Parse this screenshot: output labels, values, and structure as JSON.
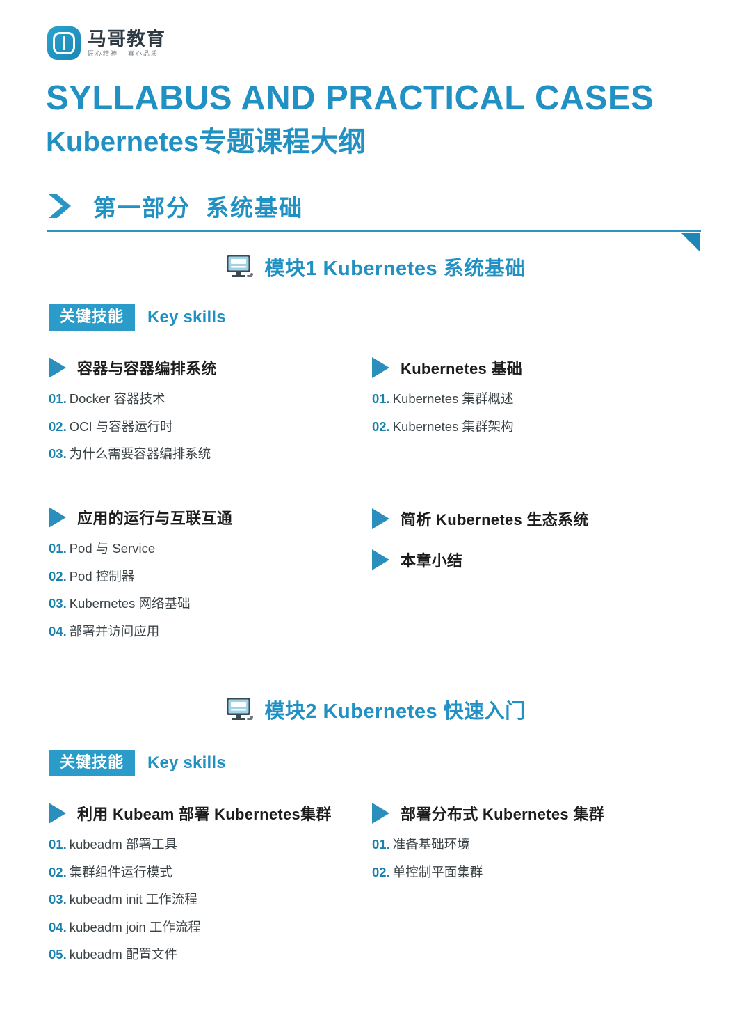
{
  "brand": {
    "name": "马哥教育",
    "tagline": "匠心精神 · 真心品质",
    "logo_icon": "mage-logo-icon",
    "accent_color": "#2190c2",
    "badge_color": "#2b9cc9",
    "number_color": "#1b82ad"
  },
  "header": {
    "title_en": "SYLLABUS AND PRACTICAL CASES",
    "title_cn": "Kubernetes专题课程大纲"
  },
  "part": {
    "chevron_icon": "chevron-right-icon",
    "label": "第一部分",
    "name": "系统基础",
    "corner_icon": "triangle-accent-icon"
  },
  "modules": [
    {
      "icon": "desktop-computer-icon",
      "title": "模块1 Kubernetes 系统基础",
      "skills_badge": "关键技能",
      "skills_en": "Key skills",
      "groups": [
        {
          "bullet_icon": "triangle-right-icon",
          "name": "容器与容器编排系统",
          "items": [
            {
              "num": "01.",
              "text": "Docker 容器技术"
            },
            {
              "num": "02.",
              "text": "OCI 与容器运行时"
            },
            {
              "num": "03.",
              "text": "为什么需要容器编排系统"
            }
          ]
        },
        {
          "bullet_icon": "triangle-right-icon",
          "name": "Kubernetes 基础",
          "items": [
            {
              "num": "01.",
              "text": "Kubernetes 集群概述"
            },
            {
              "num": "02.",
              "text": "Kubernetes 集群架构"
            }
          ]
        },
        {
          "bullet_icon": "triangle-right-icon",
          "name": "应用的运行与互联互通",
          "items": [
            {
              "num": "01.",
              "text": "Pod 与 Service"
            },
            {
              "num": "02.",
              "text": "Pod 控制器"
            },
            {
              "num": "03.",
              "text": "Kubernetes 网络基础"
            },
            {
              "num": "04.",
              "text": "部署并访问应用"
            }
          ]
        },
        {
          "bullet_icon": "triangle-right-icon",
          "name": "简析 Kubernetes 生态系统",
          "items": []
        },
        {
          "bullet_icon": "triangle-right-icon",
          "name": "本章小结",
          "items": []
        }
      ]
    },
    {
      "icon": "desktop-computer-icon",
      "title": "模块2 Kubernetes 快速入门",
      "skills_badge": "关键技能",
      "skills_en": "Key skills",
      "groups": [
        {
          "bullet_icon": "triangle-right-icon",
          "name": "利用 Kubeam 部署 Kubernetes集群",
          "items": [
            {
              "num": "01.",
              "text": "kubeadm 部署工具"
            },
            {
              "num": "02.",
              "text": "集群组件运行模式"
            },
            {
              "num": "03.",
              "text": "kubeadm init 工作流程"
            },
            {
              "num": "04.",
              "text": "kubeadm join 工作流程"
            },
            {
              "num": "05.",
              "text": "kubeadm 配置文件"
            }
          ]
        },
        {
          "bullet_icon": "triangle-right-icon",
          "name": "部署分布式 Kubernetes 集群",
          "items": [
            {
              "num": "01.",
              "text": "准备基础环境"
            },
            {
              "num": "02.",
              "text": "单控制平面集群"
            }
          ]
        }
      ]
    }
  ]
}
